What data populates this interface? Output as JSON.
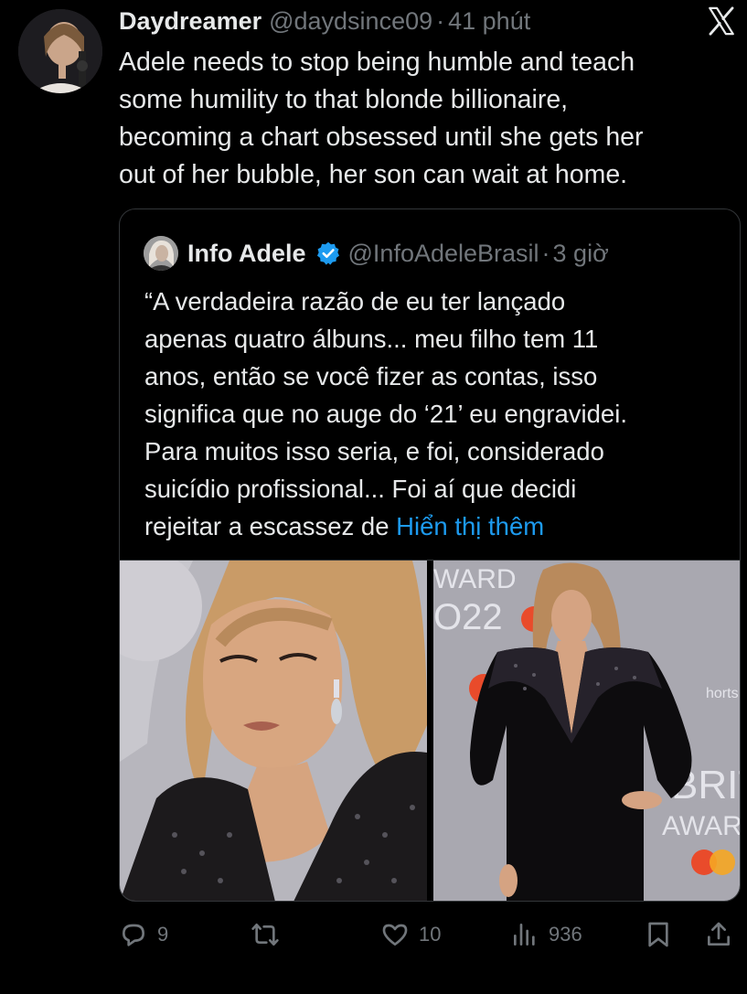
{
  "tweet": {
    "author_name": "Daydreamer",
    "author_handle": "@daydsince09",
    "separator": "·",
    "time": "41 phút",
    "text": "Adele needs to stop being humble and teach\nsome humility to that blonde billionaire,\nbecoming a chart obsessed until she gets her\nout of her bubble, her son can wait at home.",
    "avatar_icon": "user-avatar-photo",
    "platform_icon": "x-logo-icon"
  },
  "quote": {
    "author_name": "Info Adele",
    "verified_icon": "verified-badge-icon",
    "author_handle": "@InfoAdeleBrasil",
    "separator": "·",
    "time": "3 giờ",
    "text": "“A verdadeira razão de eu ter lançado\napenas quatro álbuns... meu filho tem 11\nanos, então se você fizer as contas, isso\nsignifica que no auge do ‘21’ eu engravidei.\nPara muitos isso seria, e foi, considerado\nsuicídio profissional... Foi aí que decidi\nrejeitar a escassez de ",
    "show_more": "Hiển thị thêm",
    "photos": [
      {
        "name": "photo-adele-closeup",
        "colors": {
          "bg": "#b9b8bf",
          "hair": "#c99b67",
          "skin": "#d6a47f",
          "dress": "#1c1a1c"
        }
      },
      {
        "name": "photo-adele-full-length",
        "colors": {
          "bg": "#a9a8b0",
          "hair": "#b98a5c",
          "skin": "#d5a382",
          "dress": "#0d0c0e"
        }
      }
    ],
    "backdrop_text": {
      "top": "WARD",
      "year": "O22",
      "side": "horts",
      "brand": "BRIT",
      "awards": "AWARDS"
    }
  },
  "actions": {
    "replies": "9",
    "reposts": "",
    "likes": "10",
    "views": "936",
    "icons": [
      "reply-icon",
      "repost-icon",
      "like-icon",
      "views-icon",
      "bookmark-icon",
      "share-icon"
    ]
  },
  "colors": {
    "background": "#000000",
    "text": "#e7e9ea",
    "muted": "#71767b",
    "link": "#1d9bf0",
    "border": "#333639"
  }
}
